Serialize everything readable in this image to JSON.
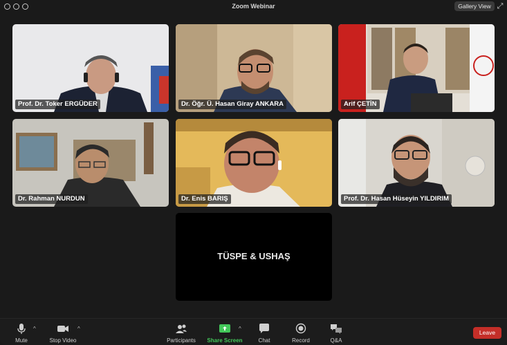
{
  "window": {
    "title": "Zoom Webinar",
    "gallery_view": "Gallery View"
  },
  "participants": [
    {
      "name": "Prof. Dr. Toker ERGÜDER"
    },
    {
      "name": "Dr. Öğr. Ü. Hasan Giray ANKARA"
    },
    {
      "name": "Arif ÇETİN"
    },
    {
      "name": "Dr. Rahman NURDUN"
    },
    {
      "name": "Dr. Enis BARIŞ"
    },
    {
      "name": "Prof. Dr. Hasan Hüseyin YILDIRIM"
    }
  ],
  "center_tile": {
    "label": "TÜSPE & USHAŞ"
  },
  "toolbar": {
    "mute": "Mute",
    "stop_video": "Stop Video",
    "participants": "Participants",
    "share_screen": "Share Screen",
    "chat": "Chat",
    "record": "Record",
    "qa": "Q&A",
    "leave": "Leave"
  },
  "colors": {
    "background": "#1a1a1a",
    "share_green": "#43c85a",
    "leave_red": "#c42e28"
  }
}
